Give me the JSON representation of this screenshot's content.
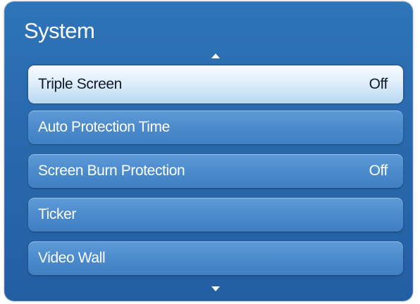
{
  "header": {
    "title": "System"
  },
  "menu": {
    "items": [
      {
        "label": "Triple Screen",
        "value": "Off",
        "selected": true
      },
      {
        "label": "Auto Protection Time",
        "value": ""
      },
      {
        "label": "Screen Burn Protection",
        "value": "Off"
      },
      {
        "label": "Ticker",
        "value": ""
      },
      {
        "label": "Video Wall",
        "value": ""
      }
    ]
  },
  "icons": {
    "scroll_up": "triangle-up-icon",
    "scroll_down": "triangle-down-icon"
  },
  "colors": {
    "panel": "#2a69ad",
    "item": "#4d8ccd",
    "selected_item": "#e3f0fb",
    "text": "#ffffff",
    "selected_text": "#0d1a2b"
  }
}
